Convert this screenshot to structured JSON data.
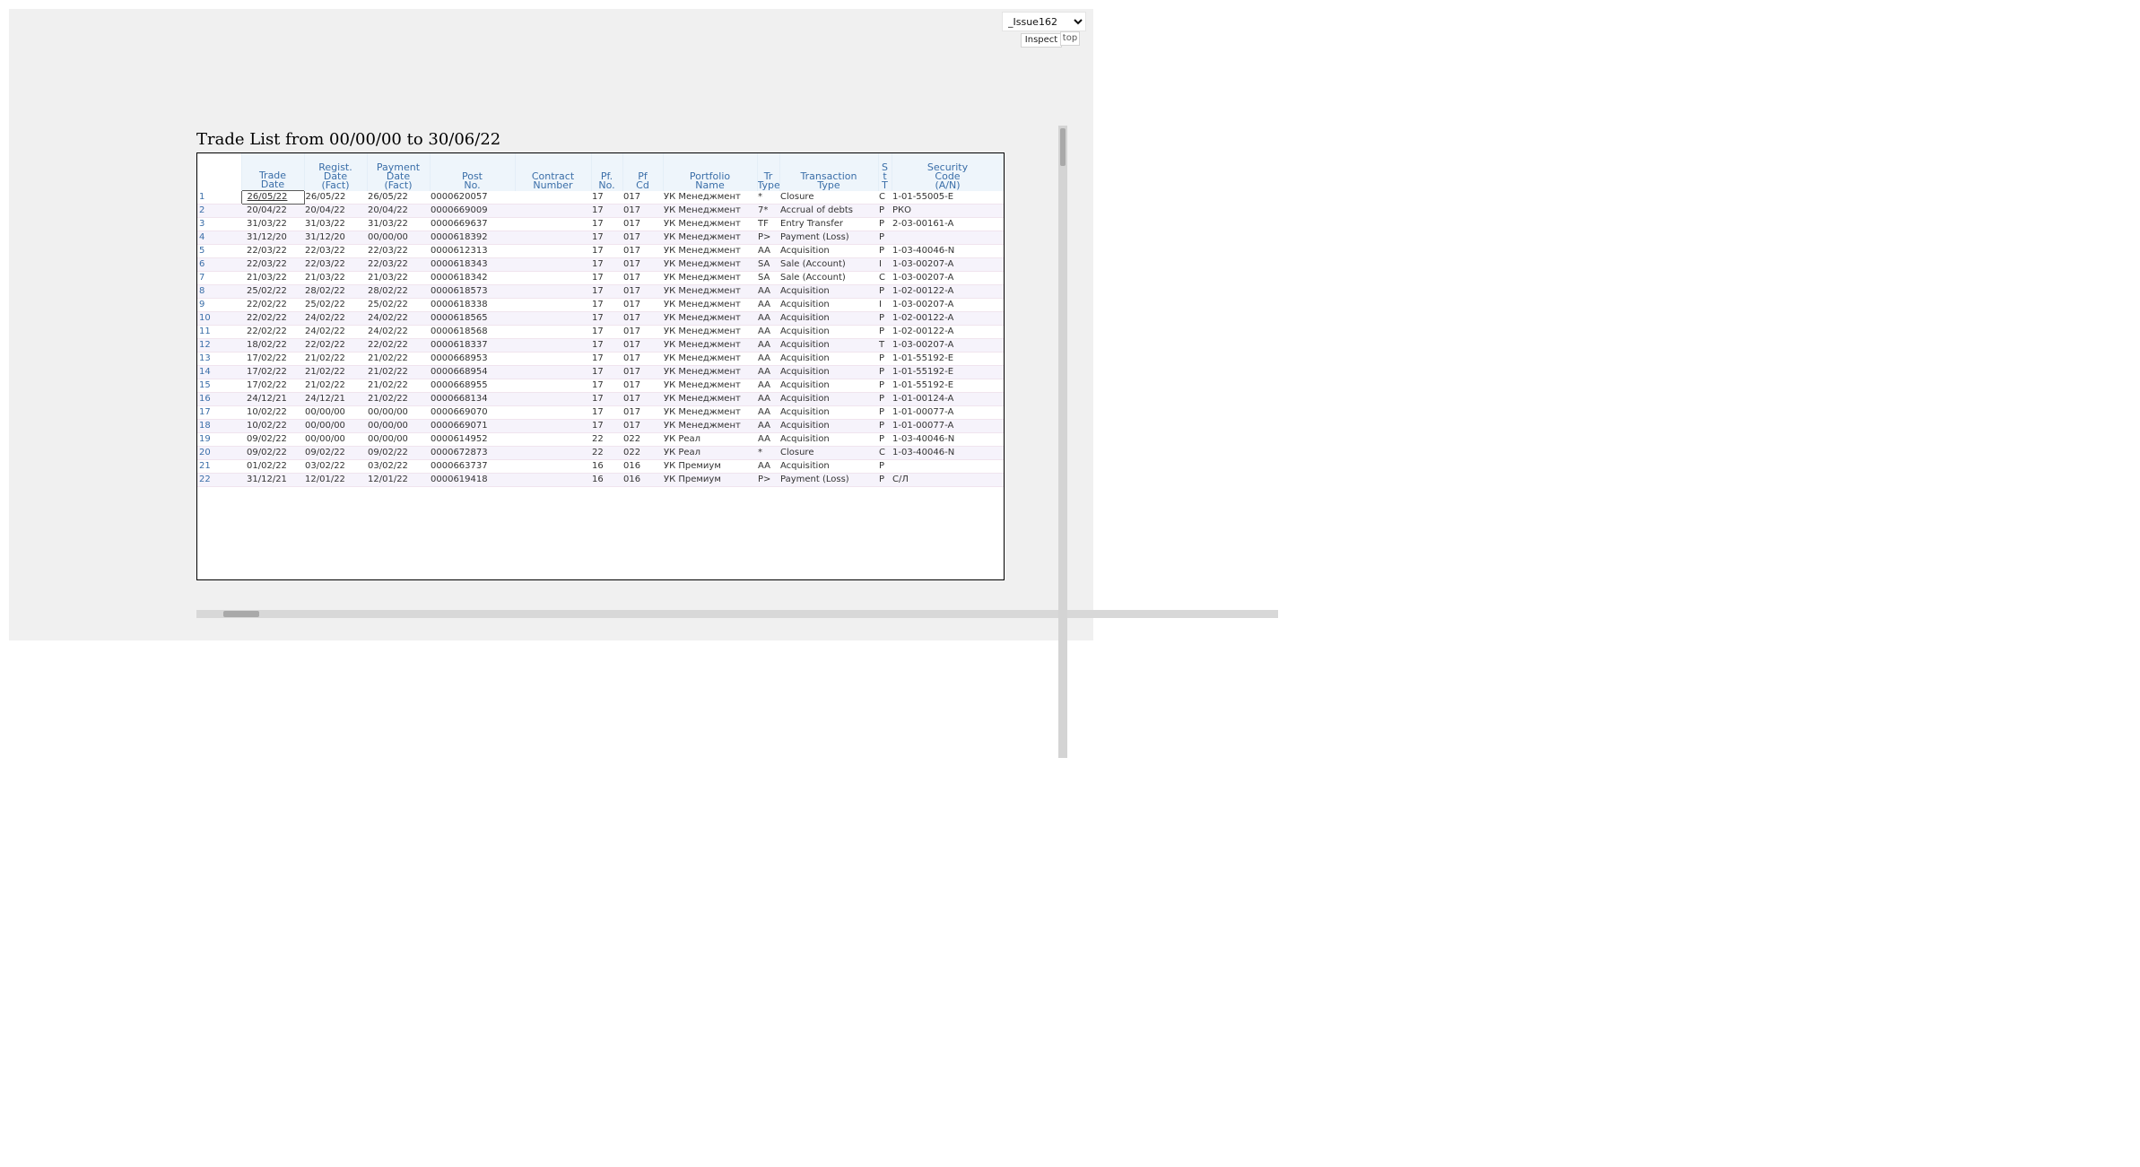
{
  "toolbar": {
    "issue_selected": "_Issue162",
    "inspect_label": "Inspect",
    "top_label": "top"
  },
  "title": "Trade List from 00/00/00 to 30/06/22",
  "columns": [
    {
      "key": "rownum",
      "label": ""
    },
    {
      "key": "trade_date",
      "label": "Trade\nDate"
    },
    {
      "key": "regist_date",
      "label": "Regist.\nDate\n(Fact)"
    },
    {
      "key": "payment_date",
      "label": "Payment\nDate\n(Fact)"
    },
    {
      "key": "post_no",
      "label": "Post\nNo."
    },
    {
      "key": "contract_number",
      "label": "Contract\nNumber"
    },
    {
      "key": "pf_no",
      "label": "Pf.\nNo."
    },
    {
      "key": "pf_cd",
      "label": "Pf\nCd"
    },
    {
      "key": "portfolio_name",
      "label": "Portfolio\nName"
    },
    {
      "key": "tr_type",
      "label": "Tr\nType"
    },
    {
      "key": "transaction_type",
      "label": "Transaction\nType"
    },
    {
      "key": "st",
      "label": "S\nt\nT"
    },
    {
      "key": "security_code",
      "label": "Security\nCode\n(A/N)"
    }
  ],
  "rows": [
    {
      "rownum": "1",
      "trade_date": "26/05/22",
      "regist_date": "26/05/22",
      "payment_date": "26/05/22",
      "post_no": "0000620057",
      "contract_number": "",
      "pf_no": "17",
      "pf_cd": "017",
      "portfolio_name": "УК Менеджмент",
      "tr_type": "*",
      "transaction_type": "Closure",
      "st": "C",
      "security_code": "1-01-55005-E"
    },
    {
      "rownum": "2",
      "trade_date": "20/04/22",
      "regist_date": "20/04/22",
      "payment_date": "20/04/22",
      "post_no": "0000669009",
      "contract_number": "",
      "pf_no": "17",
      "pf_cd": "017",
      "portfolio_name": "УК Менеджмент",
      "tr_type": "7*",
      "transaction_type": "Accrual of debts",
      "st": "P",
      "security_code": "РКО"
    },
    {
      "rownum": "3",
      "trade_date": "31/03/22",
      "regist_date": "31/03/22",
      "payment_date": "31/03/22",
      "post_no": "0000669637",
      "contract_number": "",
      "pf_no": "17",
      "pf_cd": "017",
      "portfolio_name": "УК Менеджмент",
      "tr_type": "TF",
      "transaction_type": "Entry Transfer",
      "st": "P",
      "security_code": "2-03-00161-A"
    },
    {
      "rownum": "4",
      "trade_date": "31/12/20",
      "regist_date": "31/12/20",
      "payment_date": "00/00/00",
      "post_no": "0000618392",
      "contract_number": "",
      "pf_no": "17",
      "pf_cd": "017",
      "portfolio_name": "УК Менеджмент",
      "tr_type": "P>",
      "transaction_type": "Payment (Loss)",
      "st": "P",
      "security_code": ""
    },
    {
      "rownum": "5",
      "trade_date": "22/03/22",
      "regist_date": "22/03/22",
      "payment_date": "22/03/22",
      "post_no": "0000612313",
      "contract_number": "",
      "pf_no": "17",
      "pf_cd": "017",
      "portfolio_name": "УК Менеджмент",
      "tr_type": "AA",
      "transaction_type": "Acquisition",
      "st": "P",
      "security_code": "1-03-40046-N"
    },
    {
      "rownum": "6",
      "trade_date": "22/03/22",
      "regist_date": "22/03/22",
      "payment_date": "22/03/22",
      "post_no": "0000618343",
      "contract_number": "",
      "pf_no": "17",
      "pf_cd": "017",
      "portfolio_name": "УК Менеджмент",
      "tr_type": "SA",
      "transaction_type": "Sale (Account)",
      "st": "I",
      "security_code": "1-03-00207-A"
    },
    {
      "rownum": "7",
      "trade_date": "21/03/22",
      "regist_date": "21/03/22",
      "payment_date": "21/03/22",
      "post_no": "0000618342",
      "contract_number": "",
      "pf_no": "17",
      "pf_cd": "017",
      "portfolio_name": "УК Менеджмент",
      "tr_type": "SA",
      "transaction_type": "Sale (Account)",
      "st": "C",
      "security_code": "1-03-00207-A"
    },
    {
      "rownum": "8",
      "trade_date": "25/02/22",
      "regist_date": "28/02/22",
      "payment_date": "28/02/22",
      "post_no": "0000618573",
      "contract_number": "",
      "pf_no": "17",
      "pf_cd": "017",
      "portfolio_name": "УК Менеджмент",
      "tr_type": "AA",
      "transaction_type": "Acquisition",
      "st": "P",
      "security_code": "1-02-00122-A"
    },
    {
      "rownum": "9",
      "trade_date": "22/02/22",
      "regist_date": "25/02/22",
      "payment_date": "25/02/22",
      "post_no": "0000618338",
      "contract_number": "",
      "pf_no": "17",
      "pf_cd": "017",
      "portfolio_name": "УК Менеджмент",
      "tr_type": "AA",
      "transaction_type": "Acquisition",
      "st": "I",
      "security_code": "1-03-00207-A"
    },
    {
      "rownum": "10",
      "trade_date": "22/02/22",
      "regist_date": "24/02/22",
      "payment_date": "24/02/22",
      "post_no": "0000618565",
      "contract_number": "",
      "pf_no": "17",
      "pf_cd": "017",
      "portfolio_name": "УК Менеджмент",
      "tr_type": "AA",
      "transaction_type": "Acquisition",
      "st": "P",
      "security_code": "1-02-00122-A"
    },
    {
      "rownum": "11",
      "trade_date": "22/02/22",
      "regist_date": "24/02/22",
      "payment_date": "24/02/22",
      "post_no": "0000618568",
      "contract_number": "",
      "pf_no": "17",
      "pf_cd": "017",
      "portfolio_name": "УК Менеджмент",
      "tr_type": "AA",
      "transaction_type": "Acquisition",
      "st": "P",
      "security_code": "1-02-00122-A"
    },
    {
      "rownum": "12",
      "trade_date": "18/02/22",
      "regist_date": "22/02/22",
      "payment_date": "22/02/22",
      "post_no": "0000618337",
      "contract_number": "",
      "pf_no": "17",
      "pf_cd": "017",
      "portfolio_name": "УК Менеджмент",
      "tr_type": "AA",
      "transaction_type": "Acquisition",
      "st": "T",
      "security_code": "1-03-00207-A"
    },
    {
      "rownum": "13",
      "trade_date": "17/02/22",
      "regist_date": "21/02/22",
      "payment_date": "21/02/22",
      "post_no": "0000668953",
      "contract_number": "",
      "pf_no": "17",
      "pf_cd": "017",
      "portfolio_name": "УК Менеджмент",
      "tr_type": "AA",
      "transaction_type": "Acquisition",
      "st": "P",
      "security_code": "1-01-55192-E"
    },
    {
      "rownum": "14",
      "trade_date": "17/02/22",
      "regist_date": "21/02/22",
      "payment_date": "21/02/22",
      "post_no": "0000668954",
      "contract_number": "",
      "pf_no": "17",
      "pf_cd": "017",
      "portfolio_name": "УК Менеджмент",
      "tr_type": "AA",
      "transaction_type": "Acquisition",
      "st": "P",
      "security_code": "1-01-55192-E"
    },
    {
      "rownum": "15",
      "trade_date": "17/02/22",
      "regist_date": "21/02/22",
      "payment_date": "21/02/22",
      "post_no": "0000668955",
      "contract_number": "",
      "pf_no": "17",
      "pf_cd": "017",
      "portfolio_name": "УК Менеджмент",
      "tr_type": "AA",
      "transaction_type": "Acquisition",
      "st": "P",
      "security_code": "1-01-55192-E"
    },
    {
      "rownum": "16",
      "trade_date": "24/12/21",
      "regist_date": "24/12/21",
      "payment_date": "21/02/22",
      "post_no": "0000668134",
      "contract_number": "",
      "pf_no": "17",
      "pf_cd": "017",
      "portfolio_name": "УК Менеджмент",
      "tr_type": "AA",
      "transaction_type": "Acquisition",
      "st": "P",
      "security_code": "1-01-00124-A"
    },
    {
      "rownum": "17",
      "trade_date": "10/02/22",
      "regist_date": "00/00/00",
      "payment_date": "00/00/00",
      "post_no": "0000669070",
      "contract_number": "",
      "pf_no": "17",
      "pf_cd": "017",
      "portfolio_name": "УК Менеджмент",
      "tr_type": "AA",
      "transaction_type": "Acquisition",
      "st": "P",
      "security_code": "1-01-00077-A"
    },
    {
      "rownum": "18",
      "trade_date": "10/02/22",
      "regist_date": "00/00/00",
      "payment_date": "00/00/00",
      "post_no": "0000669071",
      "contract_number": "",
      "pf_no": "17",
      "pf_cd": "017",
      "portfolio_name": "УК Менеджмент",
      "tr_type": "AA",
      "transaction_type": "Acquisition",
      "st": "P",
      "security_code": "1-01-00077-A"
    },
    {
      "rownum": "19",
      "trade_date": "09/02/22",
      "regist_date": "00/00/00",
      "payment_date": "00/00/00",
      "post_no": "0000614952",
      "contract_number": "",
      "pf_no": "22",
      "pf_cd": "022",
      "portfolio_name": "УК Реал",
      "tr_type": "AA",
      "transaction_type": "Acquisition",
      "st": "P",
      "security_code": "1-03-40046-N"
    },
    {
      "rownum": "20",
      "trade_date": "09/02/22",
      "regist_date": "09/02/22",
      "payment_date": "09/02/22",
      "post_no": "0000672873",
      "contract_number": "",
      "pf_no": "22",
      "pf_cd": "022",
      "portfolio_name": "УК Реал",
      "tr_type": "*",
      "transaction_type": "Closure",
      "st": "C",
      "security_code": "1-03-40046-N"
    },
    {
      "rownum": "21",
      "trade_date": "01/02/22",
      "regist_date": "03/02/22",
      "payment_date": "03/02/22",
      "post_no": "0000663737",
      "contract_number": "",
      "pf_no": "16",
      "pf_cd": "016",
      "portfolio_name": "УК Премиум",
      "tr_type": "AA",
      "transaction_type": "Acquisition",
      "st": "P",
      "security_code": ""
    },
    {
      "rownum": "22",
      "trade_date": "31/12/21",
      "regist_date": "12/01/22",
      "payment_date": "12/01/22",
      "post_no": "0000619418",
      "contract_number": "",
      "pf_no": "16",
      "pf_cd": "016",
      "portfolio_name": "УК Премиум",
      "tr_type": "P>",
      "transaction_type": "Payment (Loss)",
      "st": "P",
      "security_code": "С/Л"
    }
  ]
}
